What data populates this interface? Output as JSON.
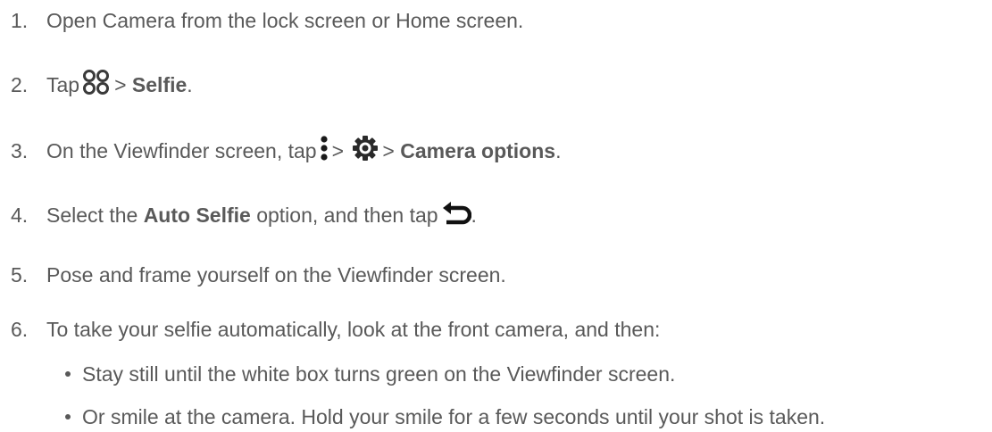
{
  "steps": [
    {
      "num": "1.",
      "text": "Open Camera from the lock screen or Home screen."
    },
    {
      "num": "2.",
      "pre": "Tap",
      "sep": ">",
      "bold": "Selfie",
      "end": ".",
      "icon": "modes-icon"
    },
    {
      "num": "3.",
      "pre": "On the Viewfinder screen, tap",
      "sep1": ">",
      "sep2": ">",
      "bold": "Camera options",
      "end": ".",
      "icons": [
        "more-options-icon",
        "settings-gear-icon"
      ]
    },
    {
      "num": "4.",
      "pre": "Select the",
      "bold": "Auto Selfie",
      "mid": "option, and then tap",
      "end": ".",
      "icon": "back-icon"
    },
    {
      "num": "5.",
      "text": "Pose and frame yourself on the Viewfinder screen."
    },
    {
      "num": "6.",
      "text": "To take your selfie automatically, look at the front camera, and then:"
    }
  ],
  "bullets": [
    "Stay still until the white box turns green on the Viewfinder screen.",
    "Or smile at the camera. Hold your smile for a few seconds until your shot is taken."
  ],
  "colors": {
    "text": "#595959",
    "icon": "#3a3a3a"
  }
}
